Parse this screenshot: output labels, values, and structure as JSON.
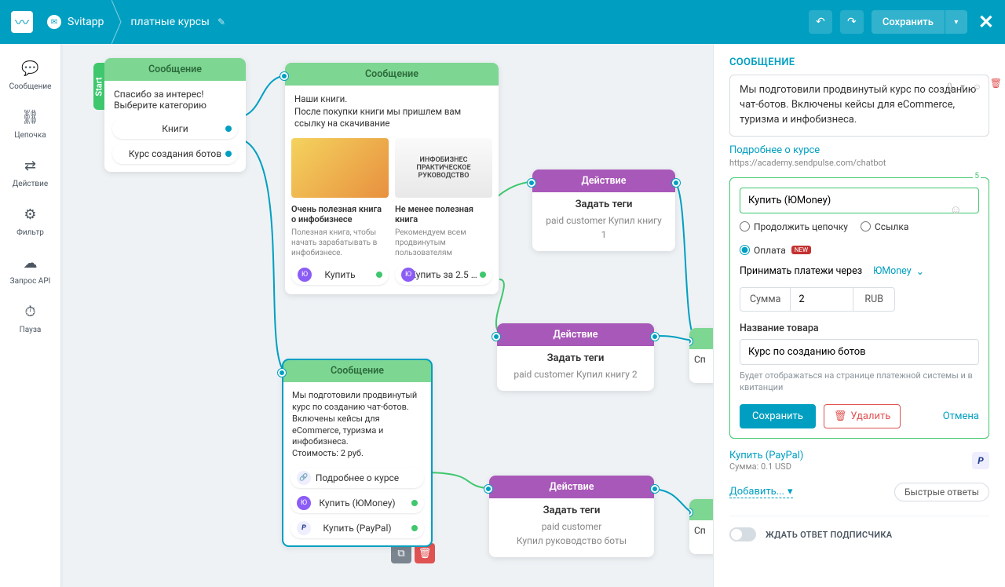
{
  "header": {
    "app": "Svitapp",
    "page": "платные курсы",
    "save": "Сохранить"
  },
  "sidebar": [
    {
      "icon": "💬",
      "label": "Сообщение"
    },
    {
      "icon": "⛓",
      "label": "Цепочка"
    },
    {
      "icon": "⇄",
      "label": "Действие"
    },
    {
      "icon": "⚙",
      "label": "Фильтр"
    },
    {
      "icon": "☁",
      "label": "Запрос API"
    },
    {
      "icon": "⏱",
      "label": "Пауза"
    }
  ],
  "nodes": {
    "start": {
      "badge": "Start",
      "title": "Сообщение",
      "text": "Спасибо за интерес!\nВыберите категорию",
      "chips": [
        "Книги",
        "Курс создания ботов"
      ]
    },
    "books": {
      "title": "Сообщение",
      "text": "Наши книги.\nПосле покупки книги мы пришлем вам ссылку на скачивание",
      "cards": [
        {
          "img": "",
          "title": "Очень полезная книга о инфобизнесе",
          "desc": "Полезная книга, чтобы начать зарабатывать в инфобизнесе.",
          "btn": "Купить"
        },
        {
          "img": "ИНФОБИЗНЕС\nПРАКТИЧЕСКОЕ\nРУКОВОДСТВО",
          "title": "Не менее полезная книга",
          "desc": "Рекомендуем всем продвинутым пользователям",
          "btn": "Купить за 2.5 …"
        }
      ]
    },
    "course": {
      "title": "Сообщение",
      "text": "Мы подготовили продвинутый курс по созданию чат-ботов. Включены кейсы для eCommerce, туризма и инфобизнеса.\nСтоимость: 2 руб.",
      "chips": [
        {
          "label": "Подробнее о курсе",
          "icon": "lk"
        },
        {
          "label": "Купить (ЮMoney)",
          "icon": "ym"
        },
        {
          "label": "Купить (PayPal)",
          "icon": "pp"
        }
      ]
    },
    "act1": {
      "title": "Действие",
      "sub": "Задать теги",
      "tags": "paid customer    Купил книгу 1"
    },
    "act2": {
      "title": "Действие",
      "sub": "Задать теги",
      "tags": "paid customer    Купил книгу 2"
    },
    "act3": {
      "title": "Действие",
      "sub": "Задать теги",
      "tags": "paid customer\nКупил руководство боты"
    },
    "peek": "Сп"
  },
  "panel": {
    "heading": "СООБЩЕНИЕ",
    "msg": "Мы подготовили продвинутый курс по созданию чат-ботов. Включены кейсы для eCommerce, туризма и инфобизнеса.",
    "link_text": "Подробнее о курсе",
    "link_url": "https://academy.sendpulse.com/chatbot",
    "counter": "5",
    "input": "Купить (ЮMoney)",
    "radios": {
      "r1": "Продолжить цепочку",
      "r2": "Ссылка",
      "r3": "Оплата",
      "new": "NEW"
    },
    "payvia_label": "Принимать платежи через",
    "payvia_value": "ЮMoney",
    "amount_label": "Сумма",
    "amount_value": "2",
    "amount_cur": "RUB",
    "product_label": "Название товара",
    "product_value": "Курс по созданию ботов",
    "help": "Будет отображаться на странице платежной системы и в квитанции",
    "btn_save": "Сохранить",
    "btn_del": "Удалить",
    "btn_cancel": "Отмена",
    "pp_title": "Купить (PayPal)",
    "pp_sub": "Сумма: 0.1 USD",
    "add": "Добавить...",
    "quick": "Быстрые ответы",
    "wait": "ЖДАТЬ ОТВЕТ ПОДПИСЧИКА"
  }
}
